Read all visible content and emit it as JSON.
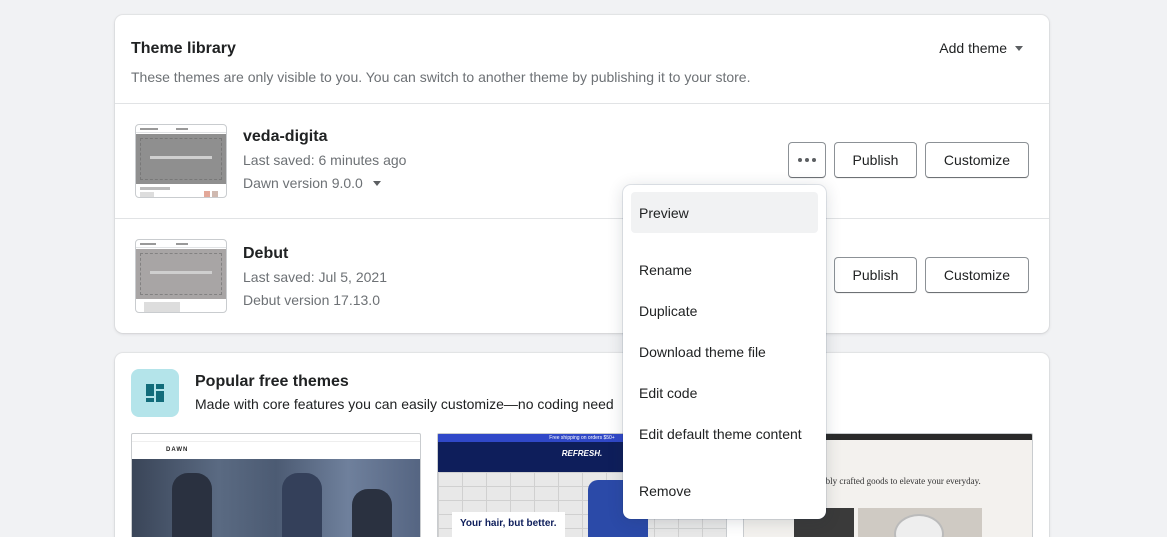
{
  "library": {
    "title": "Theme library",
    "description": "These themes are only visible to you. You can switch to another theme by publishing it to your store.",
    "add_theme_label": "Add theme",
    "themes": [
      {
        "name": "veda-digita",
        "last_saved": "Last saved: 6 minutes ago",
        "version": "Dawn version 9.0.0",
        "publish_label": "Publish",
        "customize_label": "Customize"
      },
      {
        "name": "Debut",
        "last_saved": "Last saved: Jul 5, 2021",
        "version": "Debut version 17.13.0",
        "publish_label": "Publish",
        "customize_label": "Customize"
      }
    ]
  },
  "popular": {
    "title": "Popular free themes",
    "description": "Made with core features you can easily customize—no coding need",
    "previews": [
      {
        "nav_text": "DAWN",
        "banner_text": ""
      },
      {
        "nav_text": "REFRESH.",
        "banner_text": "Free shipping on orders $50+",
        "overlay_text": "Your hair, but better."
      },
      {
        "headline": "Sustainably crafted goods to elevate your everyday."
      }
    ]
  },
  "menu": {
    "items": [
      "Preview",
      "Rename",
      "Duplicate",
      "Download theme file",
      "Edit code",
      "Edit default theme content",
      "Remove"
    ]
  },
  "colors": {
    "accent_icon_bg": "#b4e4ea",
    "menu_active_bg": "#f1f2f3"
  }
}
